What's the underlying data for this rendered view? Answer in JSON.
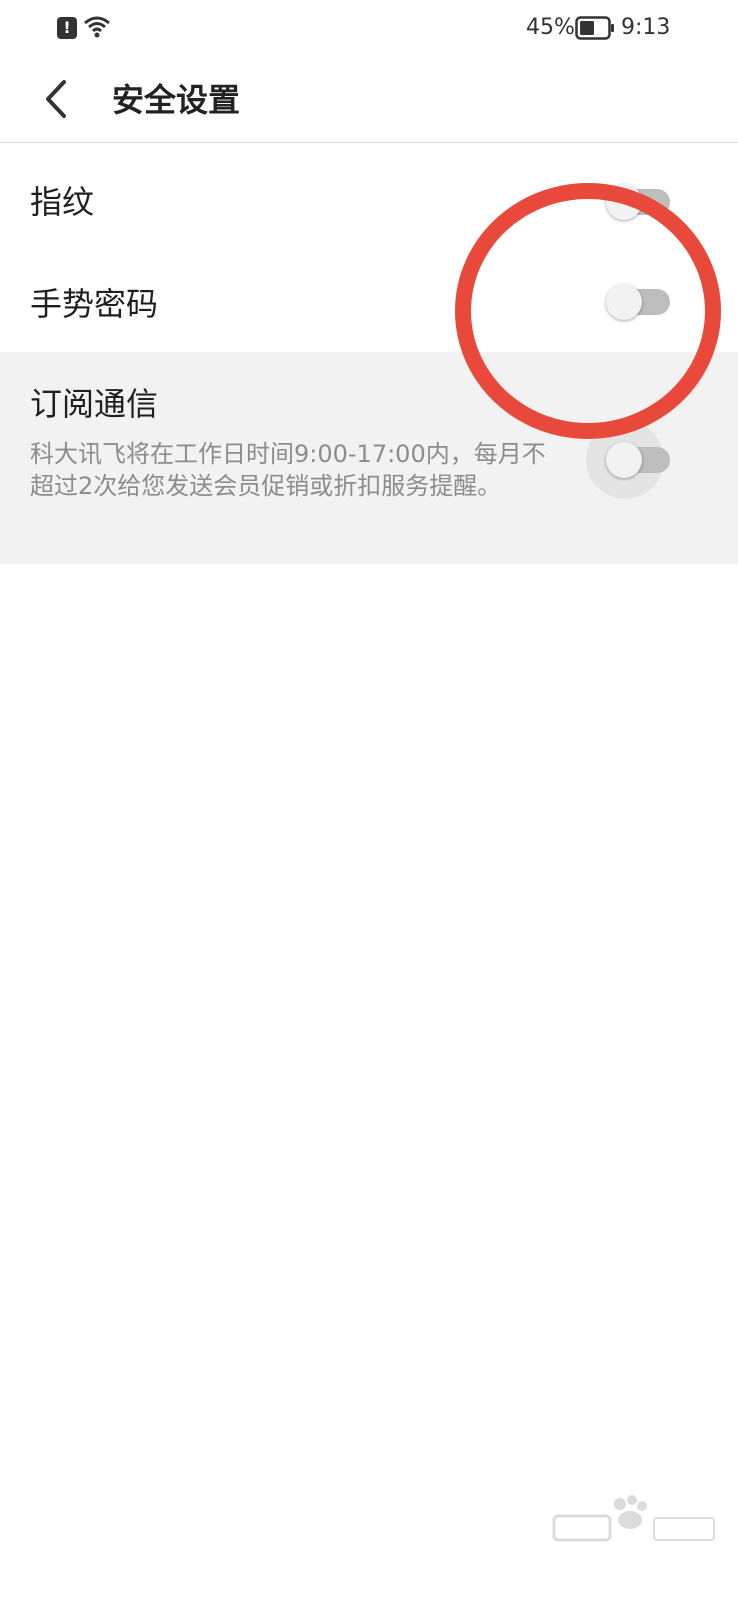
{
  "status_bar": {
    "battery_percent": "45%",
    "time": "9:13",
    "alert_icon": "alert-icon",
    "wifi_icon": "wifi-icon",
    "battery_icon": "battery-icon"
  },
  "header": {
    "title": "安全设置",
    "back_icon": "chevron-left-icon"
  },
  "settings": {
    "fingerprint": {
      "label": "指纹",
      "enabled": false
    },
    "gesture_password": {
      "label": "手势密码",
      "enabled": false
    },
    "subscribe": {
      "label": "订阅通信",
      "description": "科大讯飞将在工作日时间9:00-17:00内，每月不超过2次给您发送会员促销或折扣服务提醒。",
      "enabled": false
    }
  },
  "colors": {
    "annotation_red": "#e8493a",
    "highlight_row_bg": "#f2f2f2",
    "toggle_track_off": "#bdbdbd"
  }
}
